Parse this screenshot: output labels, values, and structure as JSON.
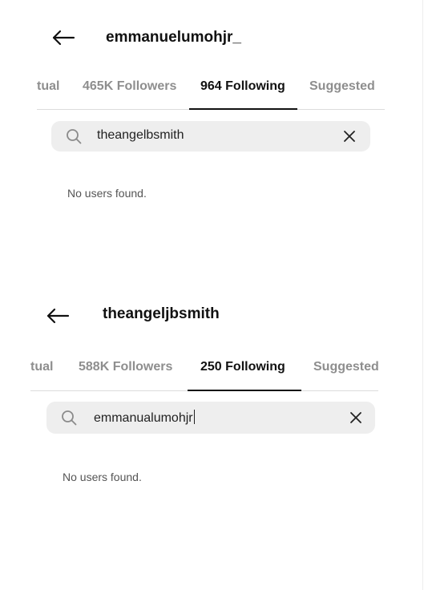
{
  "screens": [
    {
      "username": "emmanuelumohjr_",
      "tabs": [
        "tual",
        "465K Followers",
        "964 Following",
        "Suggested"
      ],
      "active_tab": 2,
      "search": {
        "value": "theangelbsmith"
      },
      "empty_message": "No users found."
    },
    {
      "username": "theangeljbsmith",
      "tabs": [
        "tual",
        "588K Followers",
        "250 Following",
        "Suggested"
      ],
      "active_tab": 2,
      "search": {
        "value": "emmanualumohjr"
      },
      "empty_message": "No users found."
    }
  ],
  "icons": {
    "back": "arrow-left-icon",
    "search": "search-icon",
    "clear": "close-icon"
  }
}
